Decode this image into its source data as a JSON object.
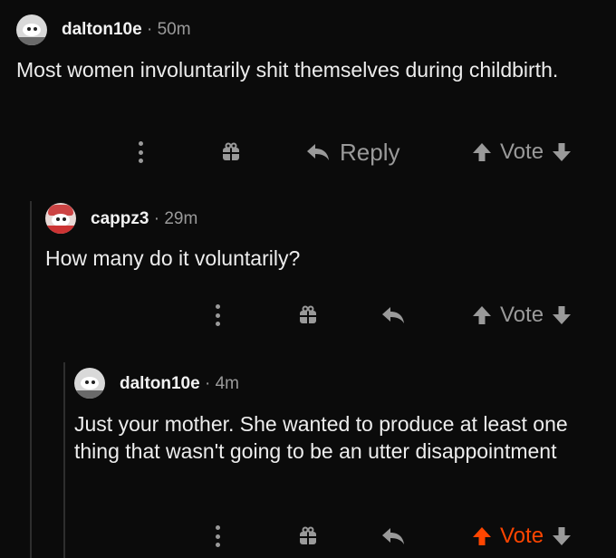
{
  "comments": [
    {
      "user": "dalton10e",
      "dot": "·",
      "time": "50m",
      "text": "Most women involuntarily shit themselves during childbirth.",
      "reply_label": "Reply",
      "vote_label": "Vote",
      "upvoted": false
    },
    {
      "user": "cappz3",
      "dot": "·",
      "time": "29m",
      "text": "How many do it voluntarily?",
      "reply_label": "",
      "vote_label": "Vote",
      "upvoted": false
    },
    {
      "user": "dalton10e",
      "dot": "·",
      "time": "4m",
      "text": "Just your mother. She wanted to produce at least one thing that wasn't going to be an utter disappointment",
      "reply_label": "",
      "vote_label": "Vote",
      "upvoted": true
    }
  ],
  "colors": {
    "background": "#0b0b0b",
    "muted": "#9a9a9a",
    "upvote_active": "#ff4500",
    "thread_line": "#2e2e2e"
  },
  "icons": [
    "more-options-icon",
    "gift-icon",
    "reply-icon",
    "upvote-icon",
    "downvote-icon",
    "avatar"
  ]
}
